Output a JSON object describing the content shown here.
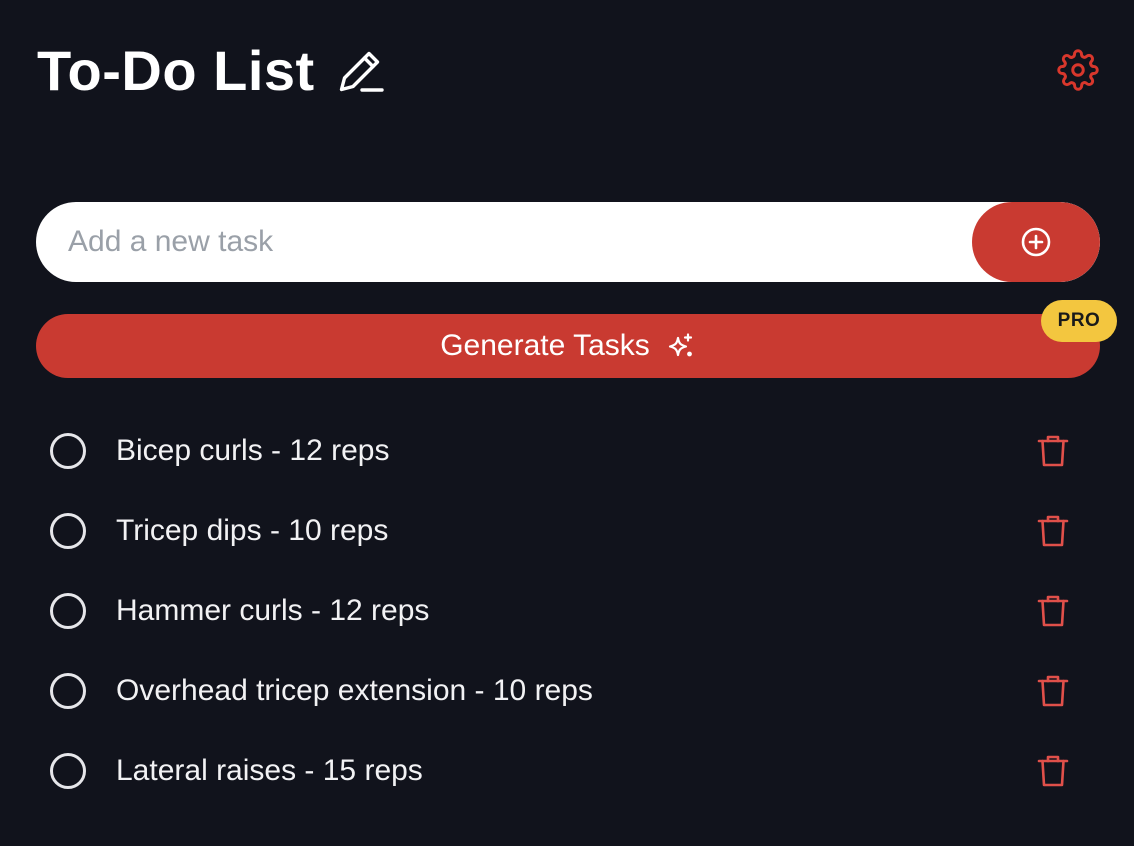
{
  "header": {
    "title": "To-Do List",
    "edit_icon": "pencil-icon",
    "settings_icon": "gear-icon"
  },
  "add_task": {
    "value": "",
    "placeholder": "Add a new task",
    "button_icon": "plus-circle-icon"
  },
  "generate": {
    "label": "Generate Tasks",
    "icon": "sparkles-icon",
    "badge": "PRO"
  },
  "tasks": [
    {
      "text": "Bicep curls - 12 reps",
      "done": false
    },
    {
      "text": "Tricep dips - 10 reps",
      "done": false
    },
    {
      "text": "Hammer curls - 12 reps",
      "done": false
    },
    {
      "text": "Overhead tricep extension - 10 reps",
      "done": false
    },
    {
      "text": "Lateral raises - 15 reps",
      "done": false
    }
  ],
  "colors": {
    "background": "#11131c",
    "accent": "#c93a31",
    "badge": "#f3c63f",
    "delete_icon": "#e0504a"
  }
}
